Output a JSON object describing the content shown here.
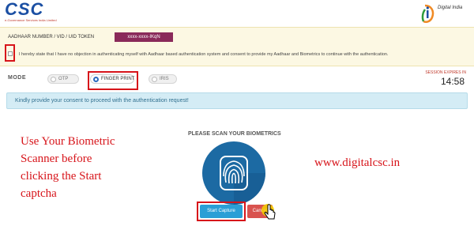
{
  "header": {
    "logo_text": "CSC",
    "logo_subtext": "e-Governance Services India Limited",
    "partner_logo_text": "Digital India"
  },
  "consent": {
    "aadhaar_label": "AADHAAR NUMBER / VID / UID TOKEN",
    "aadhaar_value": "xxxx-xxxx-IKqN",
    "statement": "I hereby state that I have no objection in authenticating myself with Aadhaar based authentication system and consent to provide my Aadhaar and Biometrics to continue with the authentication."
  },
  "mode": {
    "label": "MODE",
    "options": [
      "OTP",
      "FINGER PRINT",
      "IRIS"
    ],
    "selected": "FINGER PRINT"
  },
  "session": {
    "label": "SESSION EXPIRES IN",
    "time": "14:58"
  },
  "info_message": "Kindly provide your consent to proceed with the authentication request!",
  "scan": {
    "title": "PLEASE SCAN YOUR BIOMETRICS",
    "icon": "fingerprint-icon",
    "start_label": "Start Capture",
    "cancel_label": "Cancel"
  },
  "annotations": {
    "left_lines": [
      "Use Your Biometric",
      "Scanner before",
      "clicking the Start",
      "captcha"
    ],
    "right": "www.digitalcsc.in"
  },
  "colors": {
    "highlight_red": "#d7141a",
    "aadhaar_badge": "#8a2a5a",
    "info_bg": "#d4ecf5",
    "start_button": "#2a9fd6",
    "cancel_button": "#d9534f",
    "biometric_circle": "#1c6aa3"
  }
}
